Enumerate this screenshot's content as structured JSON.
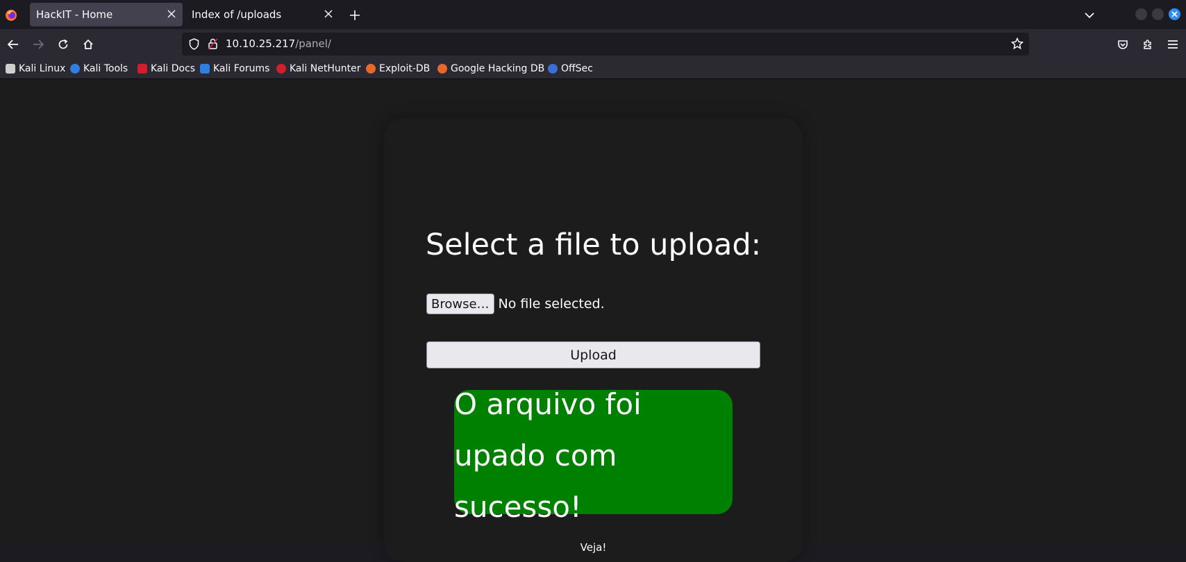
{
  "browser": {
    "tabs": [
      {
        "title": "HackIT - Home",
        "active": true
      },
      {
        "title": "Index of /uploads",
        "active": false
      }
    ],
    "url": {
      "host": "10.10.25.217",
      "path": "/panel/"
    },
    "bookmarks": [
      {
        "label": "Kali Linux",
        "icon": "kali-dragon-icon",
        "color": "#cfcfcf"
      },
      {
        "label": "Kali Tools",
        "icon": "kali-tools-icon",
        "color": "#2f7ee0"
      },
      {
        "label": "Kali Docs",
        "icon": "kali-docs-icon",
        "color": "#d21f2b"
      },
      {
        "label": "Kali Forums",
        "icon": "kali-forums-icon",
        "color": "#2f7ee0"
      },
      {
        "label": "Kali NetHunter",
        "icon": "kali-nethunter-icon",
        "color": "#d21f2b"
      },
      {
        "label": "Exploit-DB",
        "icon": "exploit-db-icon",
        "color": "#e8682a"
      },
      {
        "label": "Google Hacking DB",
        "icon": "ghdb-icon",
        "color": "#e8682a"
      },
      {
        "label": "OffSec",
        "icon": "offsec-icon",
        "color": "#3b6fd8"
      }
    ]
  },
  "page": {
    "title": "Select a file to upload:",
    "browse_label": "Browse…",
    "file_status": "No file selected.",
    "upload_label": "Upload",
    "success_message": "O arquivo foi upado com sucesso!",
    "link_label": "Veja!"
  },
  "colors": {
    "success_bg": "#008000",
    "page_bg": "#1c1c1c",
    "accent": "#2e8ef7"
  }
}
